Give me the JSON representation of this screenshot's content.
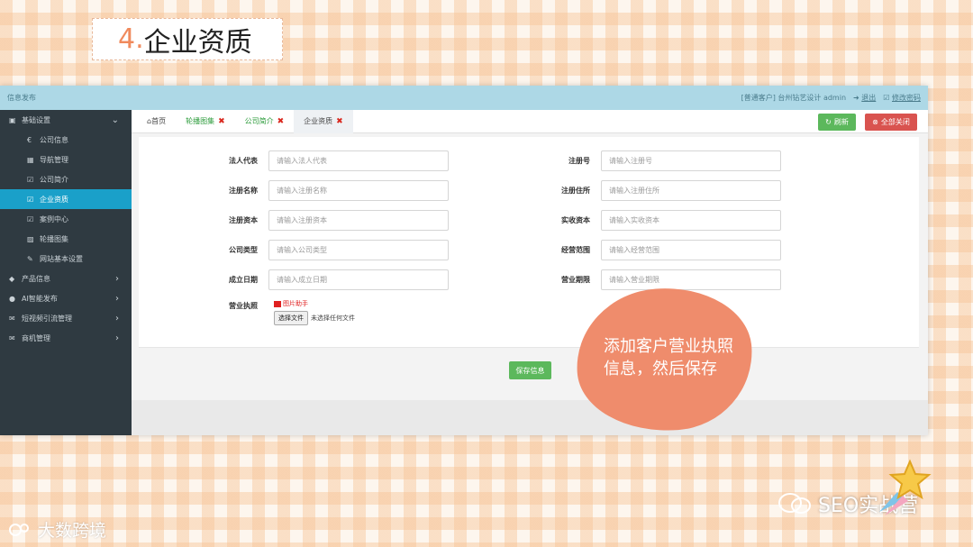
{
  "slide": {
    "number": "4.",
    "title": "企业资质"
  },
  "topbar": {
    "left": "信息发布",
    "right_text": "[普通客户] 台州钻艺设计 admin",
    "logout": "退出",
    "change_pwd": "修改密码"
  },
  "sidebar": {
    "groups": [
      {
        "label": "基础设置",
        "icon": "monitor-icon"
      },
      {
        "label": "产品信息",
        "icon": "tag-icon"
      },
      {
        "label": "AI智能发布",
        "icon": "pin-icon"
      },
      {
        "label": "短视频引流管理",
        "icon": "mail-icon"
      },
      {
        "label": "商机管理",
        "icon": "mail-icon"
      }
    ],
    "sub_items": [
      {
        "label": "公司信息",
        "icon": "euro-icon"
      },
      {
        "label": "导航管理",
        "icon": "grid-icon"
      },
      {
        "label": "公司简介",
        "icon": "edit-icon"
      },
      {
        "label": "企业资质",
        "icon": "edit-icon"
      },
      {
        "label": "案例中心",
        "icon": "edit-icon"
      },
      {
        "label": "轮播图集",
        "icon": "image-icon"
      },
      {
        "label": "网站基本设置",
        "icon": "pencil-icon"
      }
    ]
  },
  "tabs": {
    "home": "首页",
    "t1": "轮播图集",
    "t2": "公司简介",
    "t3": "企业资质",
    "refresh": "刷新",
    "close_all": "全部关闭"
  },
  "form": {
    "fields": [
      {
        "label": "法人代表",
        "placeholder": "请输入法人代表"
      },
      {
        "label": "注册号",
        "placeholder": "请输入注册号"
      },
      {
        "label": "注册名称",
        "placeholder": "请输入注册名称"
      },
      {
        "label": "注册住所",
        "placeholder": "请输入注册住所"
      },
      {
        "label": "注册资本",
        "placeholder": "请输入注册资本"
      },
      {
        "label": "实收资本",
        "placeholder": "请输入实收资本"
      },
      {
        "label": "公司类型",
        "placeholder": "请输入公司类型"
      },
      {
        "label": "经营范围",
        "placeholder": "请输入经营范围"
      },
      {
        "label": "成立日期",
        "placeholder": "请输入成立日期"
      },
      {
        "label": "营业期限",
        "placeholder": "请输入营业期限"
      }
    ],
    "license_label": "营业执照",
    "upload_hint": "图片助手",
    "file_button": "选择文件",
    "no_file": "未选择任何文件",
    "save": "保存信息"
  },
  "callout": "添加客户营业执照信息，然后保存",
  "watermarks": {
    "left": "大数跨境",
    "right": "SEO实战营"
  },
  "colors": {
    "accent_blue": "#1aa0c9",
    "green": "#5cb85c",
    "red": "#d9534f",
    "callout": "#ef8c6c"
  }
}
